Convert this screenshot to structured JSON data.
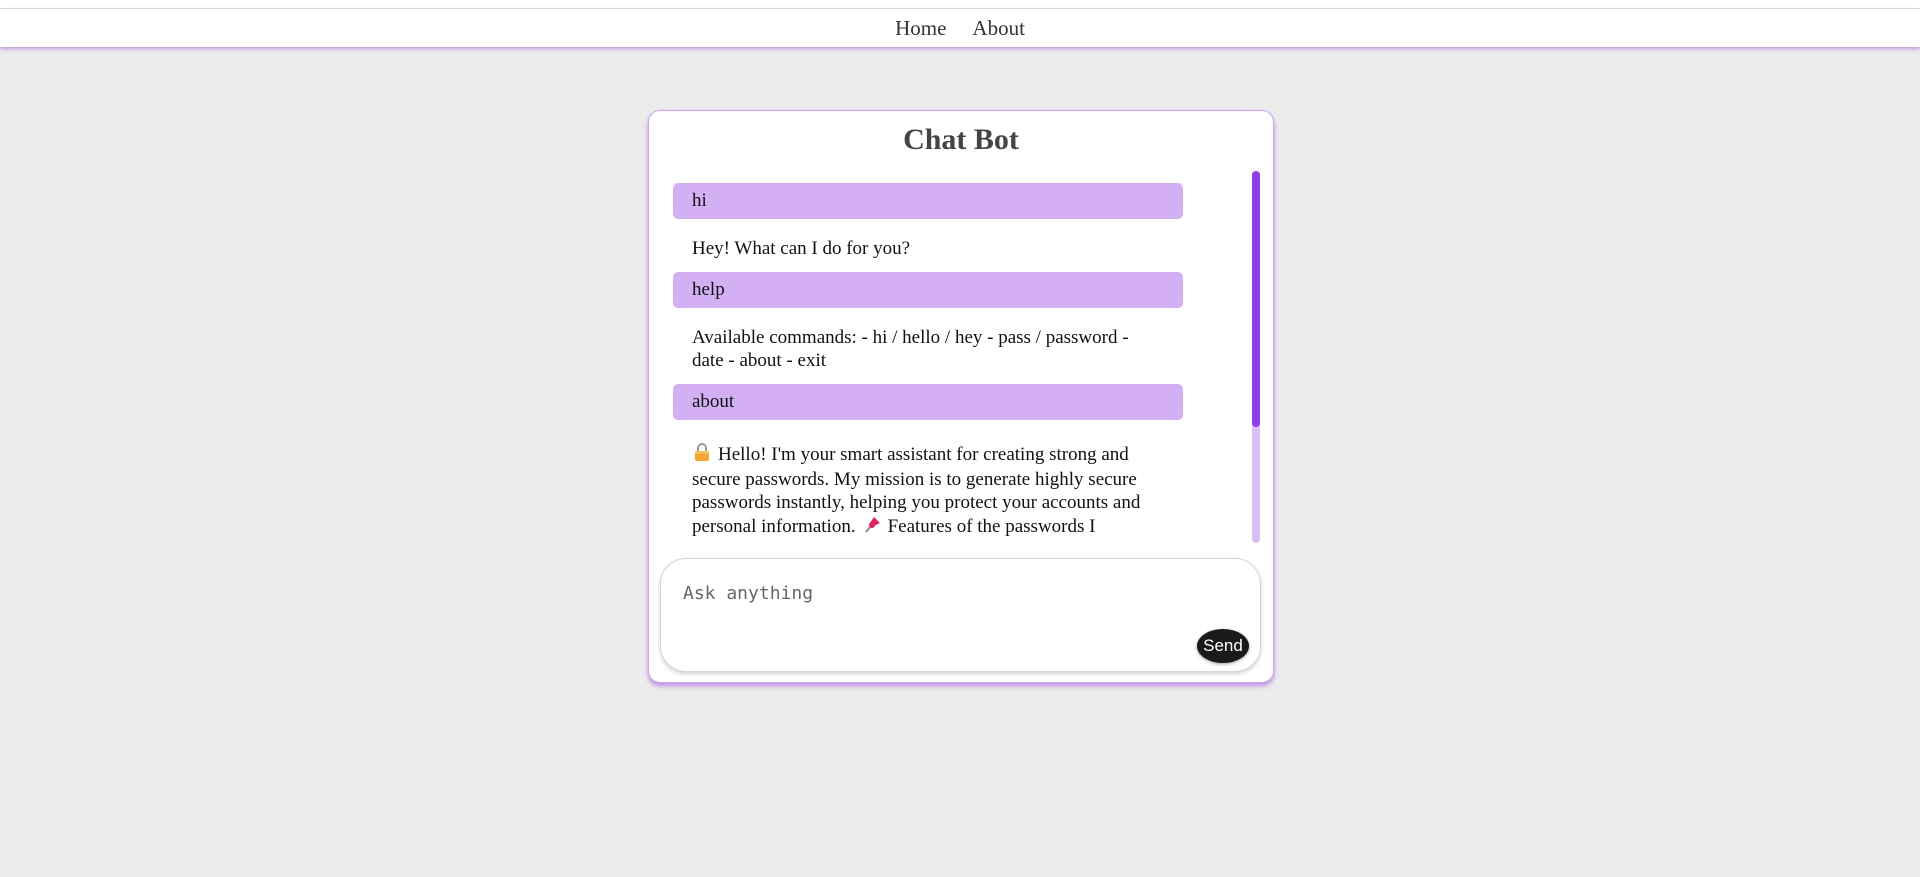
{
  "nav": {
    "links": [
      {
        "label": "Home"
      },
      {
        "label": "About"
      }
    ]
  },
  "chat": {
    "title": "Chat Bot",
    "messages": [
      {
        "role": "user",
        "text": "hi"
      },
      {
        "role": "bot",
        "text": "Hey! What can I do for you?"
      },
      {
        "role": "user",
        "text": "help"
      },
      {
        "role": "bot",
        "text": "Available commands: - hi / hello / hey - pass / password - date - about - exit"
      },
      {
        "role": "user",
        "text": "about"
      },
      {
        "role": "bot",
        "text_part1": "Hello! I'm your smart assistant for creating strong and secure passwords. My mission is to generate highly secure passwords instantly, helping you protect your accounts and personal information.",
        "text_part2": "Features of the passwords I",
        "icon_lock": "lock-icon",
        "icon_pin": "pushpin-icon"
      }
    ],
    "input": {
      "placeholder": "Ask anything",
      "value": ""
    },
    "send_label": "Send"
  },
  "colors": {
    "background": "#ececec",
    "user_bubble": "#d3aff3",
    "accent": "#8e3fe6",
    "scroll_track": "#d9bff5",
    "send_button": "#1a1a1a"
  }
}
